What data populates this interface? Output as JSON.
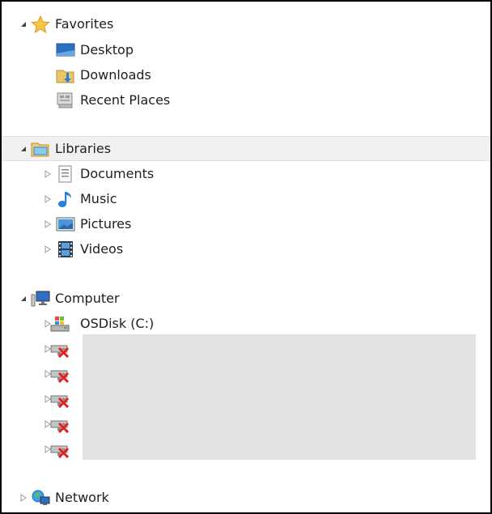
{
  "nav": {
    "favorites": {
      "label": "Favorites",
      "items": [
        {
          "label": "Desktop",
          "icon": "desktop-icon"
        },
        {
          "label": "Downloads",
          "icon": "downloads-folder-icon"
        },
        {
          "label": "Recent Places",
          "icon": "recent-places-icon"
        }
      ]
    },
    "libraries": {
      "label": "Libraries",
      "items": [
        {
          "label": "Documents",
          "icon": "documents-icon"
        },
        {
          "label": "Music",
          "icon": "music-note-icon"
        },
        {
          "label": "Pictures",
          "icon": "pictures-icon"
        },
        {
          "label": "Videos",
          "icon": "film-strip-icon"
        }
      ]
    },
    "computer": {
      "label": "Computer",
      "drive": {
        "label": "OSDisk (C:)",
        "icon": "windows-drive-icon"
      },
      "disconnected_drive_icon": "disconnected-network-drive-icon",
      "disconnected_drive_count": 5
    },
    "network": {
      "label": "Network"
    }
  },
  "colors": {
    "highlight_row": "#f1f1f1",
    "redacted_block": "#e3e3e3",
    "border": "#000000"
  }
}
